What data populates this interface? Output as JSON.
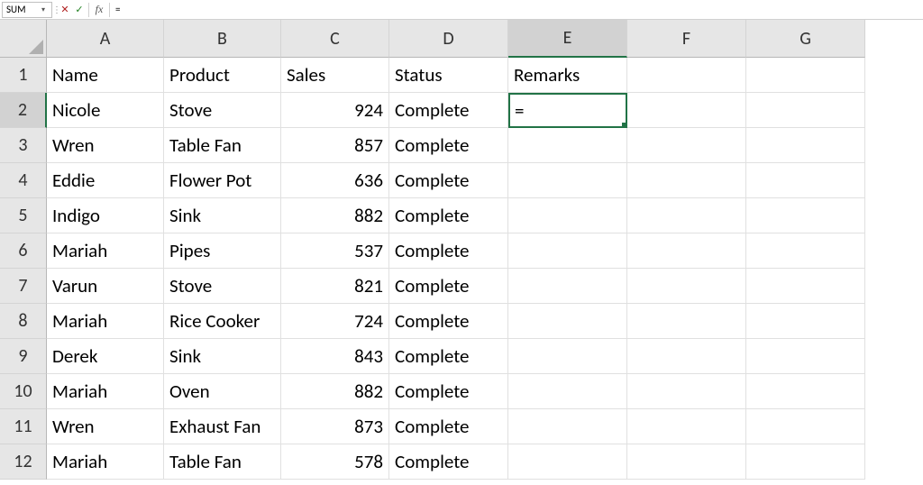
{
  "formulaBar": {
    "nameBox": "SUM",
    "cancelSymbol": "✕",
    "enterSymbol": "✓",
    "fxLabel": "fx",
    "formula": "="
  },
  "columns": [
    "A",
    "B",
    "C",
    "D",
    "E",
    "F",
    "G"
  ],
  "headers": {
    "A": "Name",
    "B": "Product",
    "C": "Sales",
    "D": "Status",
    "E": "Remarks"
  },
  "rows": [
    {
      "n": "1"
    },
    {
      "n": "2",
      "A": "Nicole",
      "B": "Stove",
      "C": "924",
      "D": "Complete",
      "E": "="
    },
    {
      "n": "3",
      "A": "Wren",
      "B": "Table Fan",
      "C": "857",
      "D": "Complete"
    },
    {
      "n": "4",
      "A": "Eddie",
      "B": "Flower Pot",
      "C": "636",
      "D": "Complete"
    },
    {
      "n": "5",
      "A": "Indigo",
      "B": "Sink",
      "C": "882",
      "D": "Complete"
    },
    {
      "n": "6",
      "A": "Mariah",
      "B": "Pipes",
      "C": "537",
      "D": "Complete"
    },
    {
      "n": "7",
      "A": "Varun",
      "B": "Stove",
      "C": "821",
      "D": "Complete"
    },
    {
      "n": "8",
      "A": "Mariah",
      "B": "Rice Cooker",
      "C": "724",
      "D": "Complete"
    },
    {
      "n": "9",
      "A": "Derek",
      "B": "Sink",
      "C": "843",
      "D": "Complete"
    },
    {
      "n": "10",
      "A": "Mariah",
      "B": "Oven",
      "C": "882",
      "D": "Complete"
    },
    {
      "n": "11",
      "A": "Wren",
      "B": "Exhaust Fan",
      "C": "873",
      "D": "Complete"
    },
    {
      "n": "12",
      "A": "Mariah",
      "B": "Table Fan",
      "C": "578",
      "D": "Complete"
    }
  ],
  "activeCell": {
    "col": "E",
    "row": 2
  }
}
